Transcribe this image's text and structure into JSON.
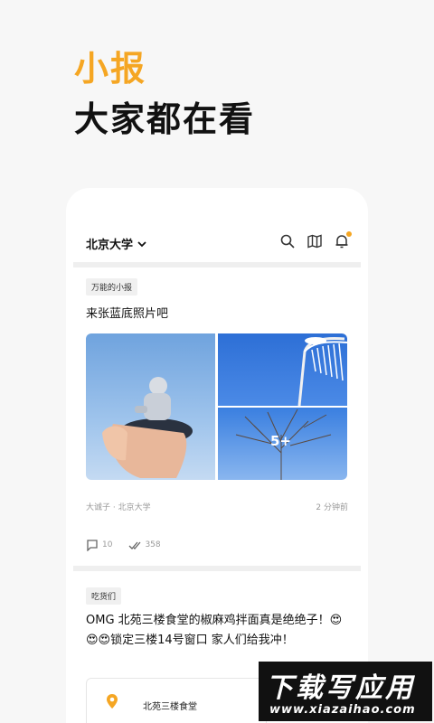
{
  "hero": {
    "accent": "小报",
    "title": "大家都在看"
  },
  "header": {
    "school": "北京大学",
    "icons": [
      "chevron-down-icon",
      "search-icon",
      "map-icon",
      "bell-icon"
    ],
    "badge_color": "#f5a623"
  },
  "posts": [
    {
      "tag": "万能的小报",
      "title": "来张蓝底照片吧",
      "more_images": "5+",
      "author": "大诚子 · 北京大学",
      "time": "2 分钟前",
      "comments": "10",
      "views": "358"
    },
    {
      "tag": "吃货们",
      "body": "OMG 北苑三楼食堂的椒麻鸡拌面真是绝绝子！😍😍😍锁定三楼14号窗口 家人们给我冲！",
      "location": "北苑三楼食堂"
    }
  ],
  "watermark": {
    "top": "下载写应用",
    "bottom": "www.xiazaihao.com"
  },
  "colors": {
    "accent": "#f5a623",
    "text": "#111111",
    "muted": "#999999"
  }
}
